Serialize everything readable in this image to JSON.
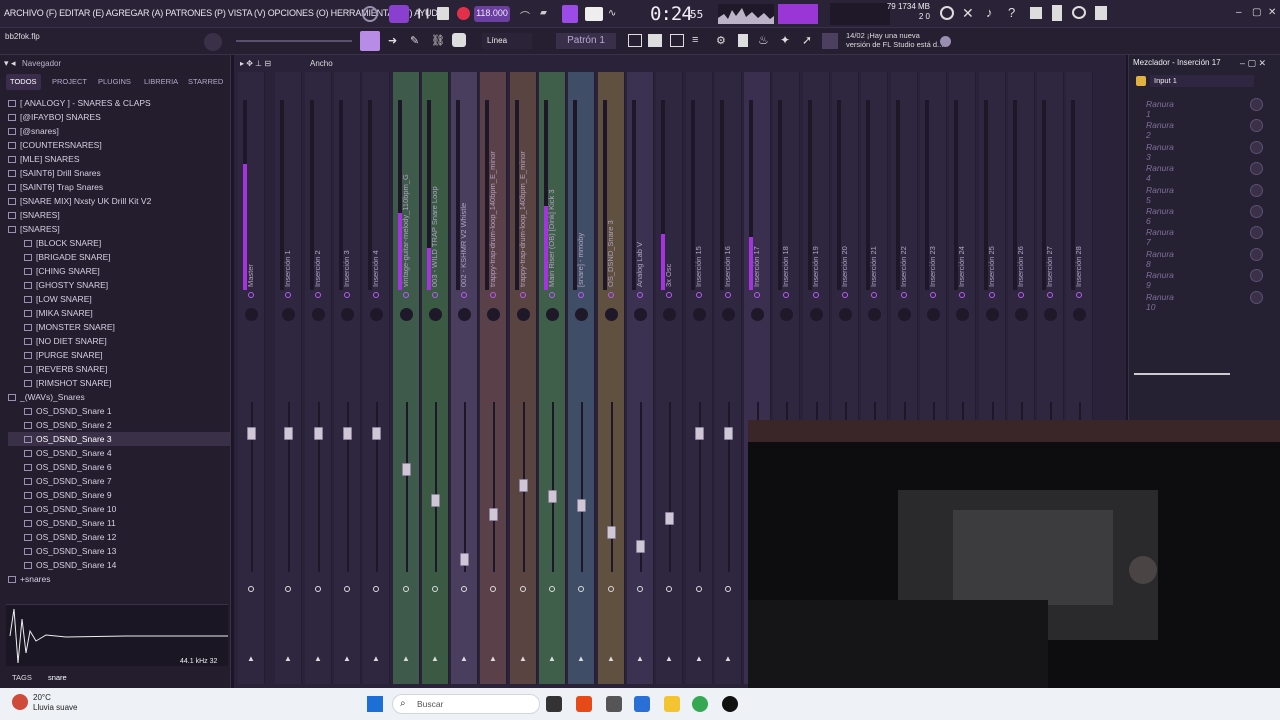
{
  "menu": {
    "text": "ARCHIVO (F) EDITAR (E) AGREGAR (A) PATRONES (P) VISTA (V) OPCIONES (O) HERRAMIENTAS (T) AYUDA"
  },
  "transport": {
    "tempo": "118.000",
    "time": "0:24",
    "time_frac": "55"
  },
  "cpu": {
    "line1": "79 1734 MB",
    "line2": "2 0"
  },
  "toolbar2": {
    "file": "bb2fok.flp",
    "snap": "Línea",
    "pattern": "Patrón 1",
    "hint_line1": "14/02 ¡Hay una nueva",
    "hint_line2": "versión de FL Studio está d..."
  },
  "browser": {
    "title": "Navegador",
    "tabs": [
      "TODOS",
      "PROJECT",
      "PLUGINS",
      "LIBRERIA",
      "STARRED"
    ],
    "items": [
      {
        "label": "[ ANALOGY ] - SNARES & CLAPS",
        "indent": 0
      },
      {
        "label": "[@IFAYBO] SNARES",
        "indent": 0
      },
      {
        "label": "[@snares]",
        "indent": 0
      },
      {
        "label": "[COUNTERSNARES]",
        "indent": 0
      },
      {
        "label": "[MLE] SNARES",
        "indent": 0
      },
      {
        "label": "[SAINT6] Drill Snares",
        "indent": 0
      },
      {
        "label": "[SAINT6] Trap Snares",
        "indent": 0
      },
      {
        "label": "[SNARE MIX] Nxsty UK Drill Kit V2",
        "indent": 0
      },
      {
        "label": "[SNARES]",
        "indent": 0
      },
      {
        "label": "[SNARES]",
        "indent": 0
      },
      {
        "label": "[BLOCK SNARE]",
        "indent": 1
      },
      {
        "label": "[BRIGADE SNARE]",
        "indent": 1
      },
      {
        "label": "[CHING SNARE]",
        "indent": 1
      },
      {
        "label": "[GHOSTY SNARE]",
        "indent": 1
      },
      {
        "label": "[LOW SNARE]",
        "indent": 1
      },
      {
        "label": "[MIKA SNARE]",
        "indent": 1
      },
      {
        "label": "[MONSTER SNARE]",
        "indent": 1
      },
      {
        "label": "[NO DIET SNARE]",
        "indent": 1
      },
      {
        "label": "[PURGE SNARE]",
        "indent": 1
      },
      {
        "label": "[REVERB SNARE]",
        "indent": 1
      },
      {
        "label": "[RIMSHOT SNARE]",
        "indent": 1
      },
      {
        "label": "_(WAVs)_Snares",
        "indent": 0
      },
      {
        "label": "OS_DSND_Snare 1",
        "indent": 1
      },
      {
        "label": "OS_DSND_Snare 2",
        "indent": 1
      },
      {
        "label": "OS_DSND_Snare 3",
        "indent": 1
      },
      {
        "label": "OS_DSND_Snare 4",
        "indent": 1
      },
      {
        "label": "OS_DSND_Snare 6",
        "indent": 1
      },
      {
        "label": "OS_DSND_Snare 7",
        "indent": 1
      },
      {
        "label": "OS_DSND_Snare 9",
        "indent": 1
      },
      {
        "label": "OS_DSND_Snare 10",
        "indent": 1
      },
      {
        "label": "OS_DSND_Snare 11",
        "indent": 1
      },
      {
        "label": "OS_DSND_Snare 12",
        "indent": 1
      },
      {
        "label": "OS_DSND_Snare 13",
        "indent": 1
      },
      {
        "label": "OS_DSND_Snare 14",
        "indent": 1
      },
      {
        "label": "+snares",
        "indent": 0
      }
    ],
    "selected_index": 24,
    "sample_info": "44.1 kHz 32",
    "tags_label": "TAGS",
    "tags_value": "snare"
  },
  "mixer": {
    "title": "Ancho",
    "panel_title": "Mezclador - Inserción 17",
    "input": "Input 1",
    "slots": [
      "Ranura 1",
      "Ranura 2",
      "Ranura 3",
      "Ranura 4",
      "Ranura 5",
      "Ranura 6",
      "Ranura 7",
      "Ranura 8",
      "Ranura 9",
      "Ranura 10"
    ],
    "tracks": [
      {
        "label": "Master",
        "level": 0.9,
        "fader": 0.75
      },
      {
        "label": "Inserción 1",
        "level": 0.0,
        "fader": 0.75
      },
      {
        "label": "Inserción 2",
        "level": 0.0,
        "fader": 0.75
      },
      {
        "label": "Inserción 3",
        "level": 0.0,
        "fader": 0.75
      },
      {
        "label": "Inserción 4",
        "level": 0.0,
        "fader": 0.75
      },
      {
        "label": "vintage-guitar-melody_110bpm_G",
        "level": 0.55,
        "fader": 0.55
      },
      {
        "label": "003 - WILD TRAP Snare Loop",
        "level": 0.3,
        "fader": 0.38
      },
      {
        "label": "002 - KSHMR V2 Whistle",
        "level": 0.0,
        "fader": 0.05
      },
      {
        "label": "trappy-trap-drum-loop_140bpm_E_minor",
        "level": 0.0,
        "fader": 0.3
      },
      {
        "label": "trappy-trap-drum-loop_140bpm_E_minor",
        "level": 0.0,
        "fader": 0.46
      },
      {
        "label": "Main Riser (OB) [Dink] Kick 3",
        "level": 0.6,
        "fader": 0.4
      },
      {
        "label": "[snare] - mmoby",
        "level": 0.0,
        "fader": 0.35
      },
      {
        "label": "OS_DSND_Snare 3",
        "level": 0.0,
        "fader": 0.2
      },
      {
        "label": "Analog Lab V",
        "level": 0.0,
        "fader": 0.12
      },
      {
        "label": "3x Osc",
        "level": 0.4,
        "fader": 0.28
      },
      {
        "label": "Inserción 15",
        "level": 0.0,
        "fader": 0.75
      },
      {
        "label": "Inserción 16",
        "level": 0.0,
        "fader": 0.75
      },
      {
        "label": "Inserción 17",
        "level": 0.38,
        "fader": 0.75
      },
      {
        "label": "Inserción 18",
        "level": 0.0,
        "fader": 0.75
      },
      {
        "label": "Inserción 19",
        "level": 0.0,
        "fader": 0.75
      },
      {
        "label": "Inserción 20",
        "level": 0.0,
        "fader": 0.75
      },
      {
        "label": "Inserción 21",
        "level": 0.0,
        "fader": 0.75
      },
      {
        "label": "Inserción 22",
        "level": 0.0,
        "fader": 0.75
      },
      {
        "label": "Inserción 23",
        "level": 0.0,
        "fader": 0.75
      },
      {
        "label": "Inserción 24",
        "level": 0.0,
        "fader": 0.75
      },
      {
        "label": "Inserción 25",
        "level": 0.0,
        "fader": 0.75
      },
      {
        "label": "Inserción 26",
        "level": 0.0,
        "fader": 0.75
      },
      {
        "label": "Inserción 27",
        "level": 0.0,
        "fader": 0.75
      },
      {
        "label": "Inserción 28",
        "level": 0.0,
        "fader": 0.75
      }
    ]
  },
  "taskbar": {
    "temp": "20°C",
    "weather": "Lluvia suave",
    "search": "Buscar"
  },
  "colors": {
    "accent": "#a633e0",
    "bg": "#2a2238"
  }
}
